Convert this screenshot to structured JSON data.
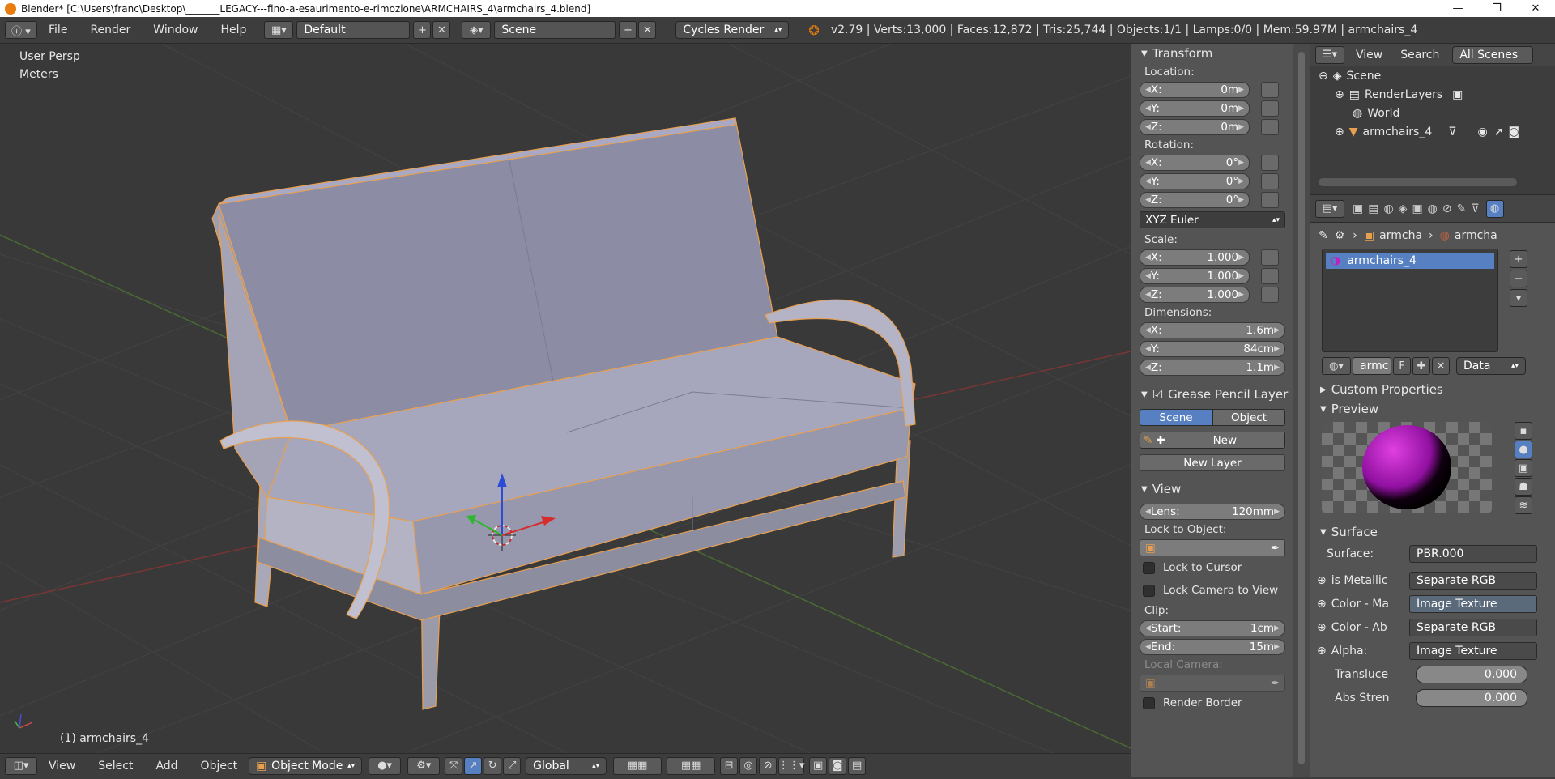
{
  "title": "Blender* [C:\\Users\\franc\\Desktop\\_______LEGACY---fino-a-esaurimento-e-rimozione\\ARMCHAIRS_4\\armchairs_4.blend]",
  "info": {
    "menus": [
      "File",
      "Render",
      "Window",
      "Help"
    ],
    "layout": "Default",
    "scene": "Scene",
    "engine": "Cycles Render",
    "stats": "v2.79 | Verts:13,000 | Faces:12,872 | Tris:25,744 | Objects:1/1 | Lamps:0/0 | Mem:59.97M | armchairs_4"
  },
  "viewport": {
    "view_name": "User Persp",
    "units": "Meters",
    "object_label": "(1) armchairs_4"
  },
  "bottom": {
    "menus": [
      "View",
      "Select",
      "Add",
      "Object"
    ],
    "mode": "Object Mode",
    "orientation": "Global"
  },
  "transform": {
    "title": "Transform",
    "location_label": "Location:",
    "location": [
      {
        "axis": "X:",
        "value": "0m"
      },
      {
        "axis": "Y:",
        "value": "0m"
      },
      {
        "axis": "Z:",
        "value": "0m"
      }
    ],
    "rotation_label": "Rotation:",
    "rotation": [
      {
        "axis": "X:",
        "value": "0°"
      },
      {
        "axis": "Y:",
        "value": "0°"
      },
      {
        "axis": "Z:",
        "value": "0°"
      }
    ],
    "rotation_mode": "XYZ Euler",
    "scale_label": "Scale:",
    "scale": [
      {
        "axis": "X:",
        "value": "1.000"
      },
      {
        "axis": "Y:",
        "value": "1.000"
      },
      {
        "axis": "Z:",
        "value": "1.000"
      }
    ],
    "dimensions_label": "Dimensions:",
    "dimensions": [
      {
        "axis": "X:",
        "value": "1.6m"
      },
      {
        "axis": "Y:",
        "value": "84cm"
      },
      {
        "axis": "Z:",
        "value": "1.1m"
      }
    ]
  },
  "grease": {
    "title": "Grease Pencil Layer",
    "tab_scene": "Scene",
    "tab_object": "Object",
    "new": "New",
    "new_layer": "New Layer"
  },
  "view": {
    "title": "View",
    "lens_label": "Lens:",
    "lens": "120mm",
    "lock_object": "Lock to Object:",
    "lock_cursor": "Lock to Cursor",
    "lock_camera": "Lock Camera to View",
    "clip_label": "Clip:",
    "start_label": "Start:",
    "start": "1cm",
    "end_label": "End:",
    "end": "15m",
    "local_camera": "Local Camera:",
    "render_border": "Render Border"
  },
  "outliner": {
    "view": "View",
    "search": "Search",
    "scenes": "All Scenes",
    "items": [
      "Scene",
      "RenderLayers",
      "World",
      "armchairs_4"
    ]
  },
  "material": {
    "crumb1": "armcha",
    "crumb2": "armcha",
    "slot": "armchairs_4",
    "mat_name": "armc",
    "fake": "F",
    "link": "Data",
    "custom_props": "Custom Properties",
    "preview": "Preview",
    "surface_title": "Surface",
    "surface_label": "Surface:",
    "surface_value": "PBR.000",
    "inputs": [
      {
        "label": "is Metallic",
        "value": "Separate RGB"
      },
      {
        "label": "Color - Ma",
        "value": "Image Texture"
      },
      {
        "label": "Color - Ab",
        "value": "Separate RGB"
      },
      {
        "label": "Alpha:",
        "value": "Image Texture"
      }
    ],
    "translucency_label": "Transluce",
    "translucency": "0.000",
    "abs_label": "Abs Stren",
    "abs": "0.000"
  },
  "colors": {
    "accent": "#5680c2",
    "orange": "#e87d0d"
  }
}
